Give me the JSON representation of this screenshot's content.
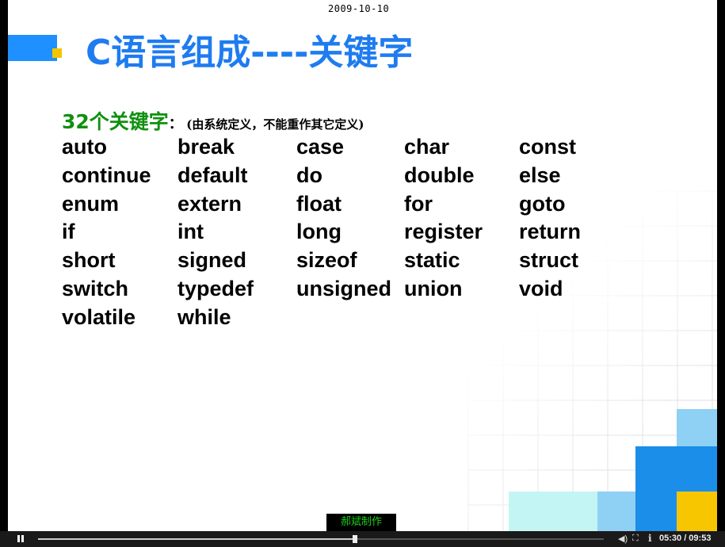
{
  "slide": {
    "date": "2009-10-10",
    "title": "C语言组成----关键字",
    "keywords_heading": {
      "count_label": "32个关键字",
      "colon": "：",
      "note": "(由系统定义，不能重作其它定义)"
    },
    "keywords": [
      [
        "auto",
        "break",
        "case",
        "char",
        "const"
      ],
      [
        "continue",
        "default",
        "do",
        "double",
        "else"
      ],
      [
        "enum",
        "extern",
        "float",
        "for",
        "goto"
      ],
      [
        "if",
        "int",
        "long",
        "register",
        "return"
      ],
      [
        "short",
        "signed",
        "sizeof",
        "static",
        "struct"
      ],
      [
        "switch",
        "typedef",
        "unsigned",
        "union",
        "void"
      ],
      [
        "volatile",
        "while"
      ]
    ],
    "watermark": "郝斌制作",
    "colors": {
      "title": "#1e7cf0",
      "heading": "#109010",
      "accent_blue": "#1e90ff",
      "accent_gold": "#f2c500"
    }
  },
  "player": {
    "progress": 0.56,
    "time": "05:30 / 09:53",
    "icons": [
      "pause-icon",
      "volume-icon",
      "fullscreen-icon",
      "info-icon"
    ]
  }
}
